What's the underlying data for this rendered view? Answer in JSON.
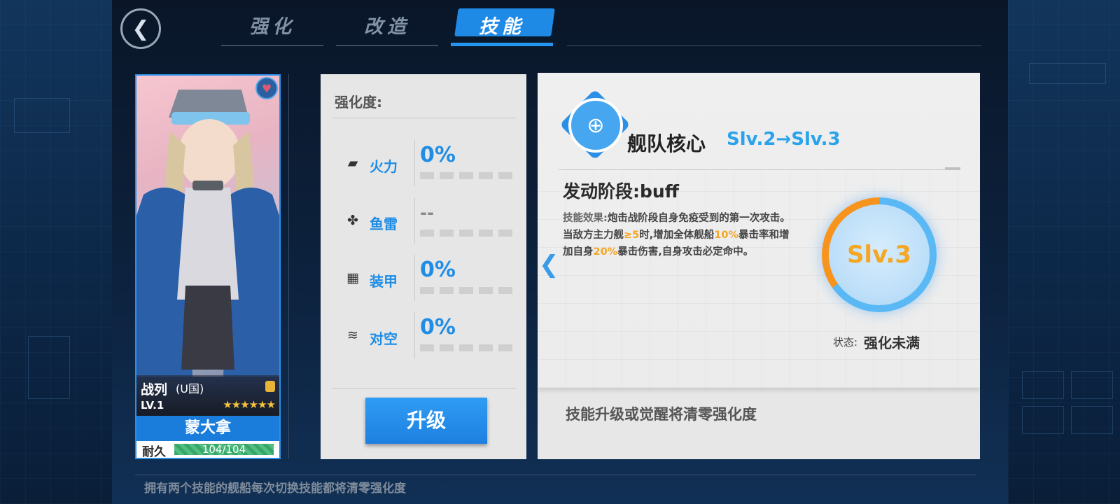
{
  "header": {
    "back_glyph": "❮",
    "tabs": [
      {
        "label": "强化",
        "active": false
      },
      {
        "label": "改造",
        "active": false
      },
      {
        "label": "技能",
        "active": true
      }
    ]
  },
  "ship": {
    "type": "战列",
    "nation": "(U国)",
    "level": "LV.1",
    "stars": "★★★★★★",
    "name": "蒙大拿",
    "durability_label": "耐久",
    "durability": "104/104",
    "durability_fraction": 1.0
  },
  "stats": {
    "title": "强化度:",
    "items": [
      {
        "icon": "firepower-icon",
        "glyph": "▰",
        "name": "火力",
        "value": "0%"
      },
      {
        "icon": "torpedo-icon",
        "glyph": "✤",
        "name": "鱼雷",
        "value": "--"
      },
      {
        "icon": "armor-icon",
        "glyph": "▦",
        "name": "装甲",
        "value": "0%"
      },
      {
        "icon": "antiair-icon",
        "glyph": "≋",
        "name": "对空",
        "value": "0%"
      }
    ],
    "upgrade_label": "升级"
  },
  "skill": {
    "icon_glyph": "⊕",
    "name": "舰队核心",
    "level_change": "Slv.2→Slv.3",
    "phase": "发动阶段:buff",
    "desc_prefix": "技能效果:",
    "desc_part1": "炮击战阶段自身免疫受到的第一次攻击。当敌方主力舰",
    "desc_hl1": "≥5",
    "desc_part2": "时,增加全体舰船",
    "desc_hl2": "10%",
    "desc_part3": "暴击率和增加自身",
    "desc_hl3": "20%",
    "desc_part4": "暴击伤害,自身攻击必定命中。",
    "level": "Slv.3",
    "status_label": "状态:",
    "status_value": "强化未满",
    "note": "技能升级或觉醒将清零强化度",
    "collapse_glyph": "❮"
  },
  "footer": {
    "text": "拥有两个技能的舰船每次切换技能都将清零强化度"
  },
  "colors": {
    "accent": "#1f8de6",
    "highlight": "#f5a623",
    "durability": "#3aa56a"
  }
}
